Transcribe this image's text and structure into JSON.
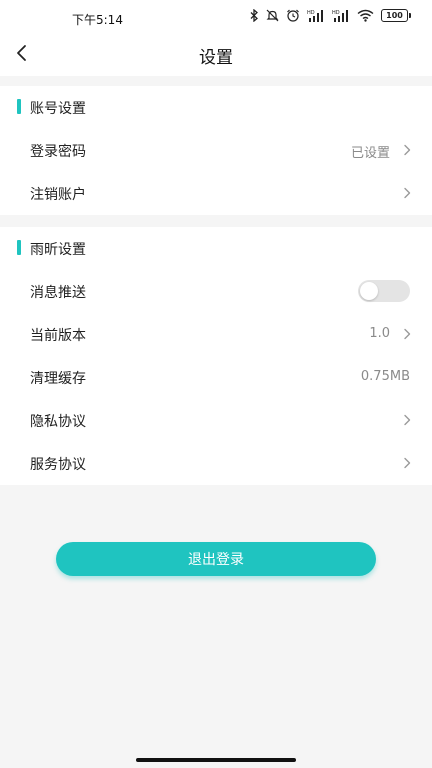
{
  "status_bar": {
    "time": "下午5:14",
    "battery": "100"
  },
  "header": {
    "title": "设置"
  },
  "account_section": {
    "title": "账号设置",
    "items": [
      {
        "label": "登录密码",
        "value": "已设置"
      },
      {
        "label": "注销账户",
        "value": ""
      }
    ]
  },
  "app_section": {
    "title": "雨昕设置",
    "items": [
      {
        "label": "消息推送",
        "toggle": false
      },
      {
        "label": "当前版本",
        "value": "1.0"
      },
      {
        "label": "清理缓存",
        "value": "0.75MB"
      },
      {
        "label": "隐私协议",
        "value": ""
      },
      {
        "label": "服务协议",
        "value": ""
      }
    ]
  },
  "logout": {
    "label": "退出登录"
  },
  "colors": {
    "accent": "#1fc4c0",
    "background": "#f5f5f5"
  }
}
